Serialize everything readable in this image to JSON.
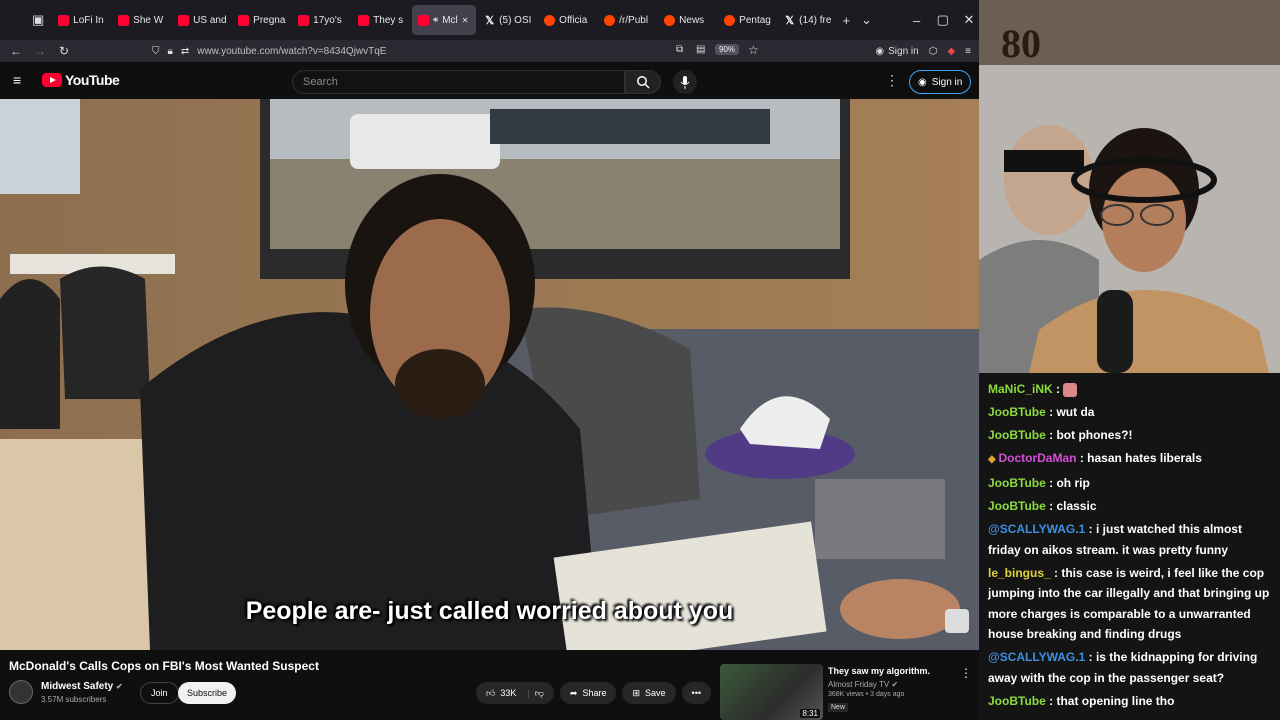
{
  "browser": {
    "tabs": [
      {
        "label": "LoFi In",
        "icon": "youtube-icon",
        "kind": "yt",
        "active": false
      },
      {
        "label": "She W",
        "icon": "youtube-icon",
        "kind": "yt",
        "active": false
      },
      {
        "label": "US and",
        "icon": "youtube-icon",
        "kind": "yt",
        "active": false
      },
      {
        "label": "Pregna",
        "icon": "youtube-icon",
        "kind": "yt",
        "active": false
      },
      {
        "label": "17yo's",
        "icon": "youtube-icon",
        "kind": "yt",
        "active": false
      },
      {
        "label": "They s",
        "icon": "youtube-icon",
        "kind": "yt",
        "active": false
      },
      {
        "label": "Mcl",
        "icon": "youtube-icon",
        "kind": "yt",
        "active": true
      },
      {
        "label": "(5) OSI",
        "icon": "x-icon",
        "kind": "x",
        "active": false
      },
      {
        "label": "Officia",
        "icon": "reddit-icon",
        "kind": "rd",
        "active": false
      },
      {
        "label": "/r/Publ",
        "icon": "reddit-icon",
        "kind": "rd",
        "active": false
      },
      {
        "label": "News",
        "icon": "reddit-icon",
        "kind": "rd",
        "active": false
      },
      {
        "label": "Pentag",
        "icon": "reddit-icon",
        "kind": "rd",
        "active": false
      },
      {
        "label": "(14) fre",
        "icon": "x-icon",
        "kind": "x",
        "active": false
      }
    ],
    "url": "www.youtube.com/watch?v=8434QjwvTqE",
    "zoom": "90%",
    "signin": "Sign in"
  },
  "youtube": {
    "logo_text": "YouTube",
    "search_placeholder": "Search",
    "signin": "Sign in",
    "caption": "People are- just called worried about you",
    "video_title": "McDonald's Calls Cops on FBI's Most Wanted Suspect",
    "channel_name": "Midwest Safety",
    "channel_subs": "3.57M subscribers",
    "join": "Join",
    "subscribe": "Subscribe",
    "likes": "33K",
    "share": "Share",
    "save": "Save",
    "recommended": {
      "title": "They saw my algorithm.",
      "channel": "Almost Friday TV",
      "meta": "368K views • 3 days ago",
      "badge": "New",
      "duration": "8:31"
    }
  },
  "stream": {
    "overlay_text": "80"
  },
  "chat": [
    {
      "user": "MaNiC_iNK",
      "text": "",
      "color": "#8cdc3c",
      "icon": "emote-icon"
    },
    {
      "user": "JooBTube",
      "text": "wut da",
      "color": "#8cdc3c"
    },
    {
      "user": "JooBTube",
      "text": "bot phones?!",
      "color": "#8cdc3c"
    },
    {
      "user": "DoctorDaMan",
      "text": "hasan hates liberals",
      "color": "#d34fd3",
      "icon": "badge-icon"
    },
    {
      "user": "JooBTube",
      "text": "oh rip",
      "color": "#8cdc3c"
    },
    {
      "user": "JooBTube",
      "text": "classic",
      "color": "#8cdc3c"
    },
    {
      "user": "@SCALLYWAG.1",
      "text": "i just watched this almost friday on aikos stream. it was pretty funny",
      "color": "#3f8fe0"
    },
    {
      "user": "le_bingus_",
      "text": "this case is weird, i feel like the cop jumping into the car illegally and that bringing up more charges is comparable to a unwarranted house breaking and finding drugs",
      "color": "#e0d13c"
    },
    {
      "user": "@SCALLYWAG.1",
      "text": "is the kidnapping for driving away with the cop in the passenger seat?",
      "color": "#3f8fe0"
    },
    {
      "user": "JooBTube",
      "text": "that opening line tho",
      "color": "#8cdc3c"
    }
  ]
}
